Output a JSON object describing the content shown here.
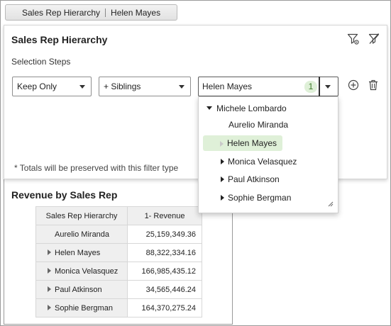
{
  "breadcrumb": {
    "part1": "Sales Rep Hierarchy",
    "part2": "Helen Mayes"
  },
  "panel": {
    "title": "Sales Rep Hierarchy",
    "steps_label": "Selection Steps",
    "action_select": "Keep Only",
    "relation_select": "+ Siblings",
    "member_value": "Helen Mayes",
    "member_count": "1",
    "totals_note": "* Totals will be preserved with this filter type"
  },
  "dropdown": {
    "parent": "Michele Lombardo",
    "items": [
      "Aurelio Miranda",
      "Helen Mayes",
      "Monica Velasquez",
      "Paul Atkinson",
      "Sophie Bergman"
    ],
    "selected_index": 1
  },
  "report": {
    "title": "Revenue by Sales Rep",
    "columns": [
      "Sales Rep Hierarchy",
      "1- Revenue"
    ],
    "rows": [
      {
        "name": "Aurelio Miranda",
        "revenue": "25,159,349.36"
      },
      {
        "name": "Helen Mayes",
        "revenue": "88,322,334.16"
      },
      {
        "name": "Monica Velasquez",
        "revenue": "166,985,435.12"
      },
      {
        "name": "Paul Atkinson",
        "revenue": "34,565,446.24"
      },
      {
        "name": "Sophie Bergman",
        "revenue": "164,370,275.24"
      }
    ]
  },
  "colors": {
    "selected_bg": "#dff0d8",
    "count_text": "#3d7a2a",
    "header_bg": "#efefef"
  },
  "icons": [
    "filter-settings-icon",
    "clear-filter-icon",
    "add-circle-icon",
    "trash-icon",
    "resize-grip-icon"
  ]
}
